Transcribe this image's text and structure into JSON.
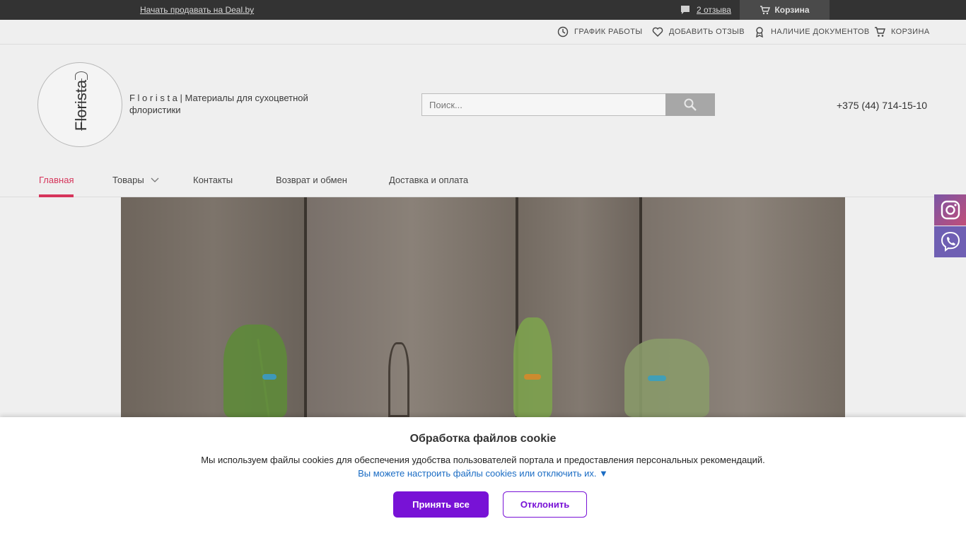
{
  "topbar": {
    "sell_link": "Начать продавать на Deal.by",
    "reviews": "2 отзыва",
    "cart": "Корзина"
  },
  "utility": {
    "items": [
      {
        "label": "ГРАФИК РАБОТЫ",
        "icon": "clock-icon"
      },
      {
        "label": "ДОБАВИТЬ ОТЗЫВ",
        "icon": "heart-icon"
      },
      {
        "label": "НАЛИЧИЕ ДОКУМЕНТОВ",
        "icon": "award-icon"
      },
      {
        "label": "КОРЗИНА",
        "icon": "cart-icon"
      }
    ]
  },
  "header": {
    "logo_text": "Florista",
    "tagline": "F l o r i s t a | Материалы для сухоцветной флористики",
    "search_placeholder": "Поиск...",
    "phone": "+375 (44) 714-15-10"
  },
  "nav": {
    "items": [
      {
        "label": "Главная",
        "active": true
      },
      {
        "label": "Товары",
        "dropdown": true
      },
      {
        "label": "Контакты"
      },
      {
        "label": "Возврат и обмен"
      },
      {
        "label": "Доставка и оплата"
      }
    ]
  },
  "social": {
    "instagram": "instagram-icon",
    "viber": "viber-icon"
  },
  "cookie": {
    "title": "Обработка файлов cookie",
    "text": "Мы используем файлы cookies для обеспечения удобства пользователей портала и предоставления персональных рекомендаций.",
    "settings_link": "Вы можете настроить файлы cookies или отключить их. ▼",
    "accept": "Принять все",
    "decline": "Отклонить"
  },
  "colors": {
    "accent": "#d6355b",
    "button": "#7812d6",
    "link": "#1a6cc4"
  }
}
